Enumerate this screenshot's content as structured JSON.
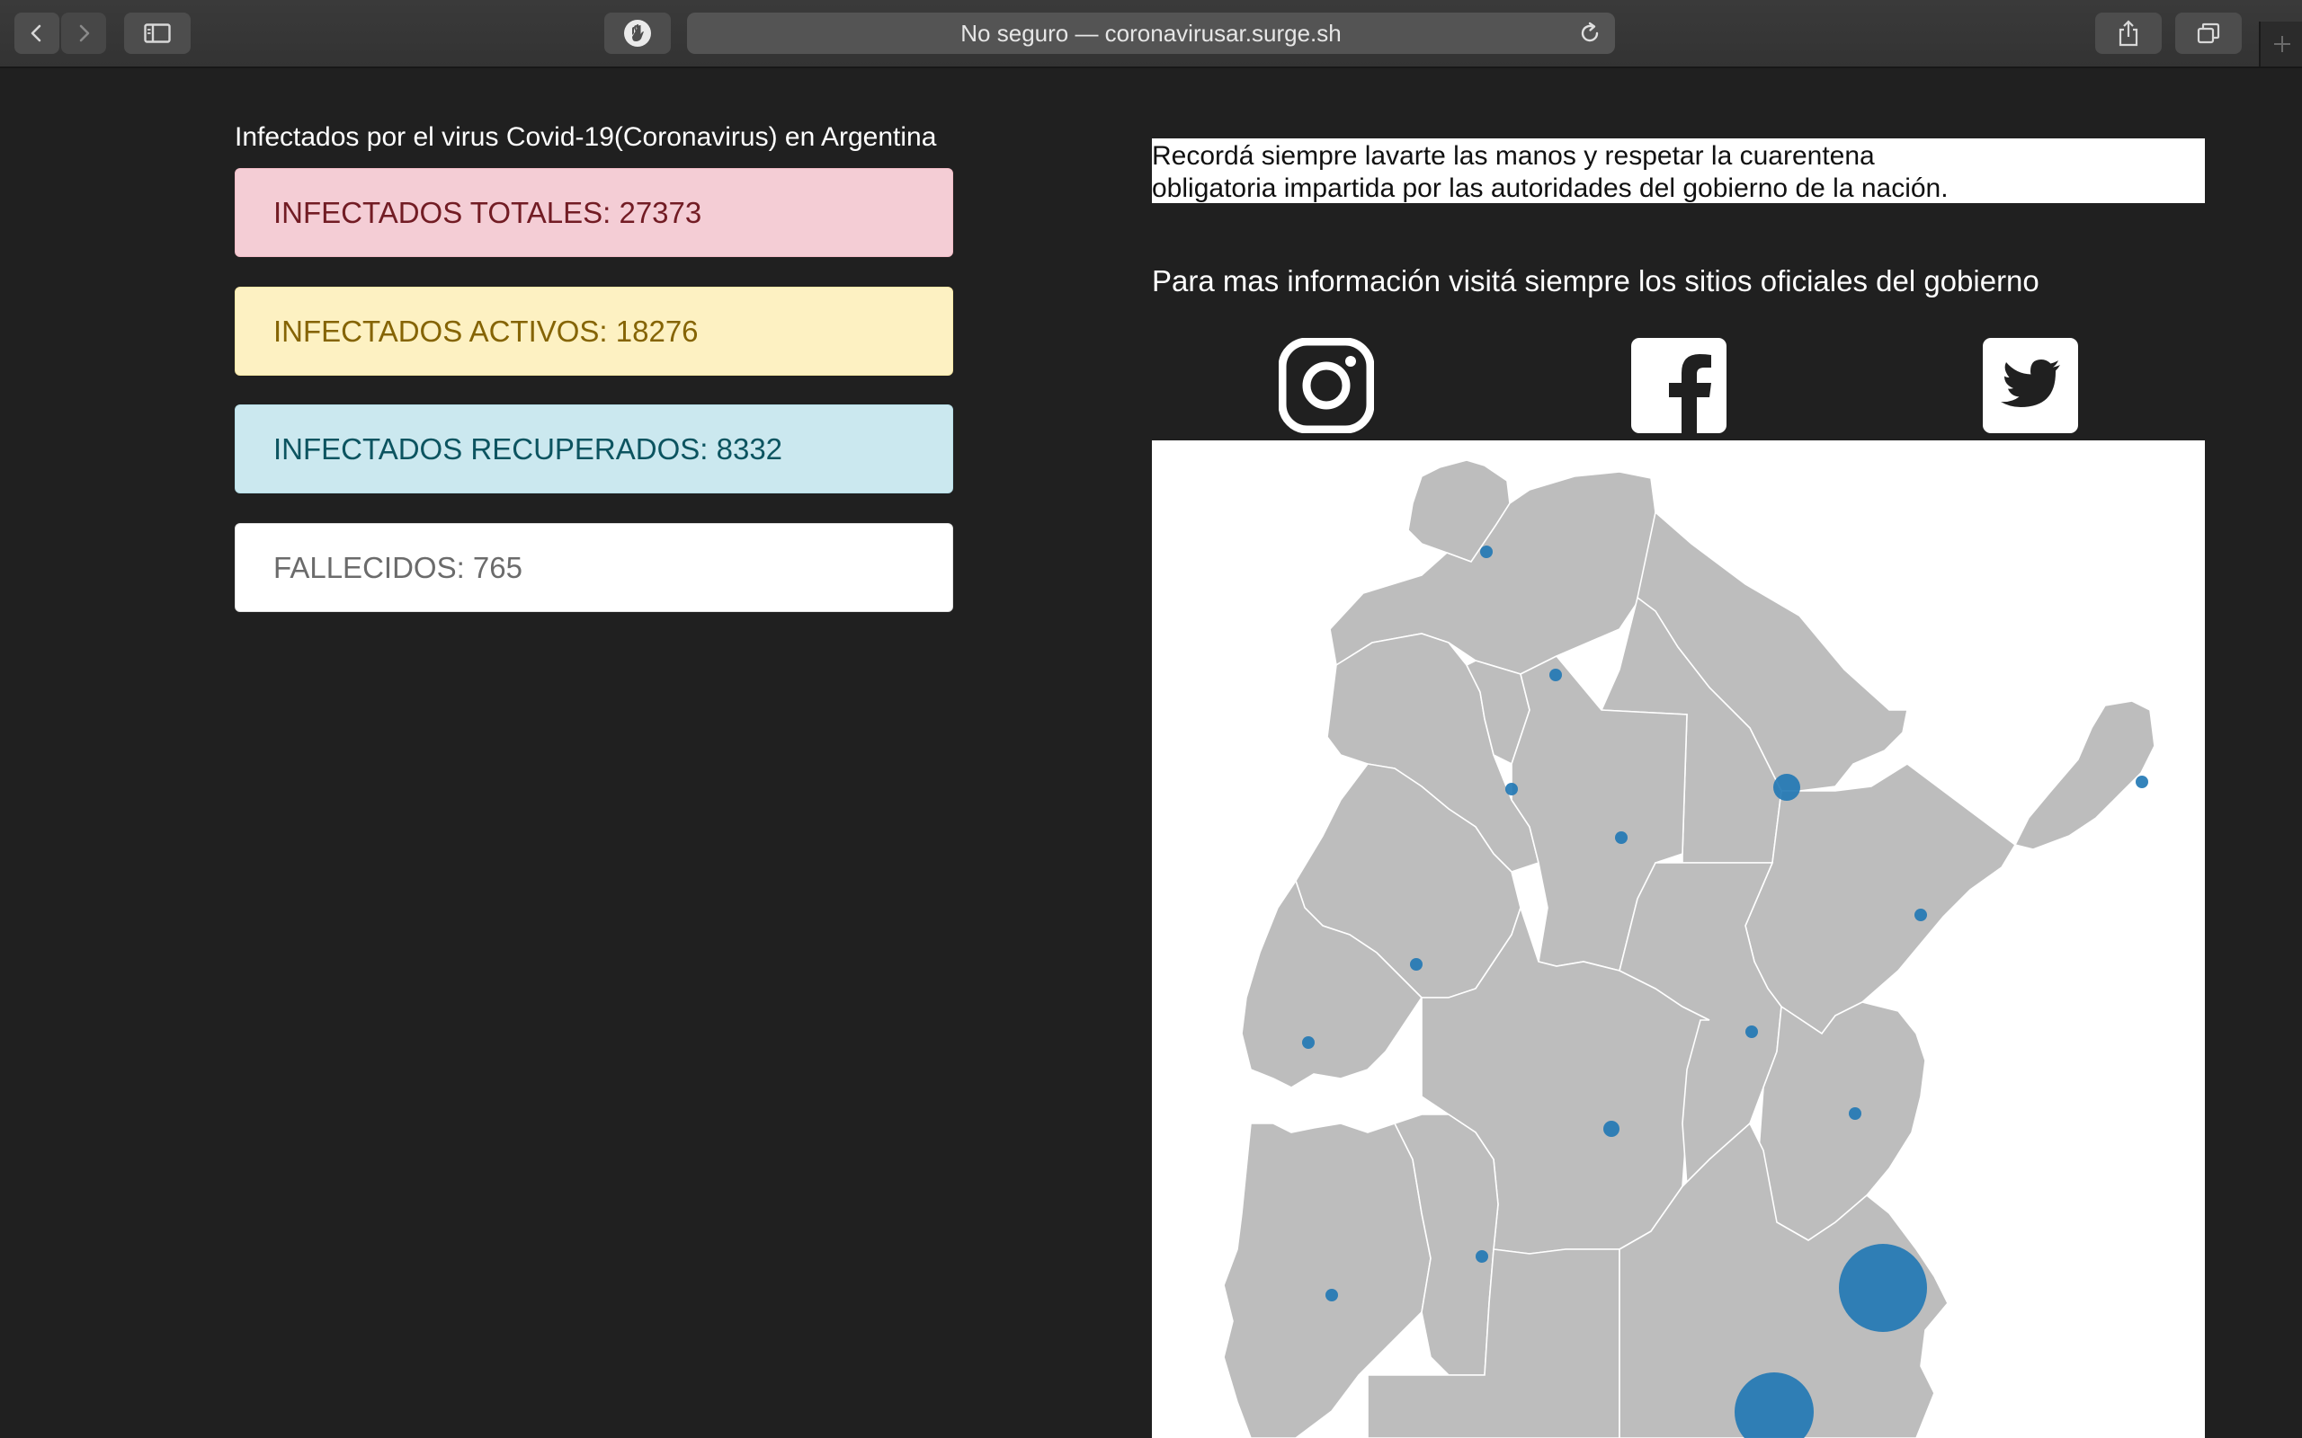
{
  "browser": {
    "address_text": "No seguro — coronavirusar.surge.sh",
    "icons": [
      "back-icon",
      "forward-icon",
      "sidebar-icon",
      "privacy-shield-icon",
      "reload-icon",
      "share-icon",
      "tabs-icon",
      "new-tab-icon"
    ]
  },
  "page": {
    "heading": "Infectados por el virus Covid-19(Coronavirus) en Argentina",
    "stats": {
      "total": "INFECTADOS TOTALES: 27373",
      "active": "INFECTADOS ACTIVOS: 18276",
      "recovered": "INFECTADOS RECUPERADOS: 8332",
      "deaths": "FALLECIDOS: 765"
    },
    "notice_line1": "Recordá siempre lavarte las manos y respetar la cuarentena",
    "notice_line2": "obligatoria impartida por las autoridades del gobierno de la nación.",
    "info_text": "Para mas información visitá siempre los sitios oficiales del gobierno",
    "social_icons": [
      "instagram-icon",
      "facebook-icon",
      "twitter-icon"
    ]
  },
  "colors": {
    "page_background": "#202020",
    "total_bg": "#f4cdd5",
    "active_bg": "#fdf1c2",
    "recovered_bg": "#cbe8ef",
    "deaths_bg": "#ffffff",
    "map_fill": "#bdbdbd",
    "bubble": "#1f77b4"
  }
}
